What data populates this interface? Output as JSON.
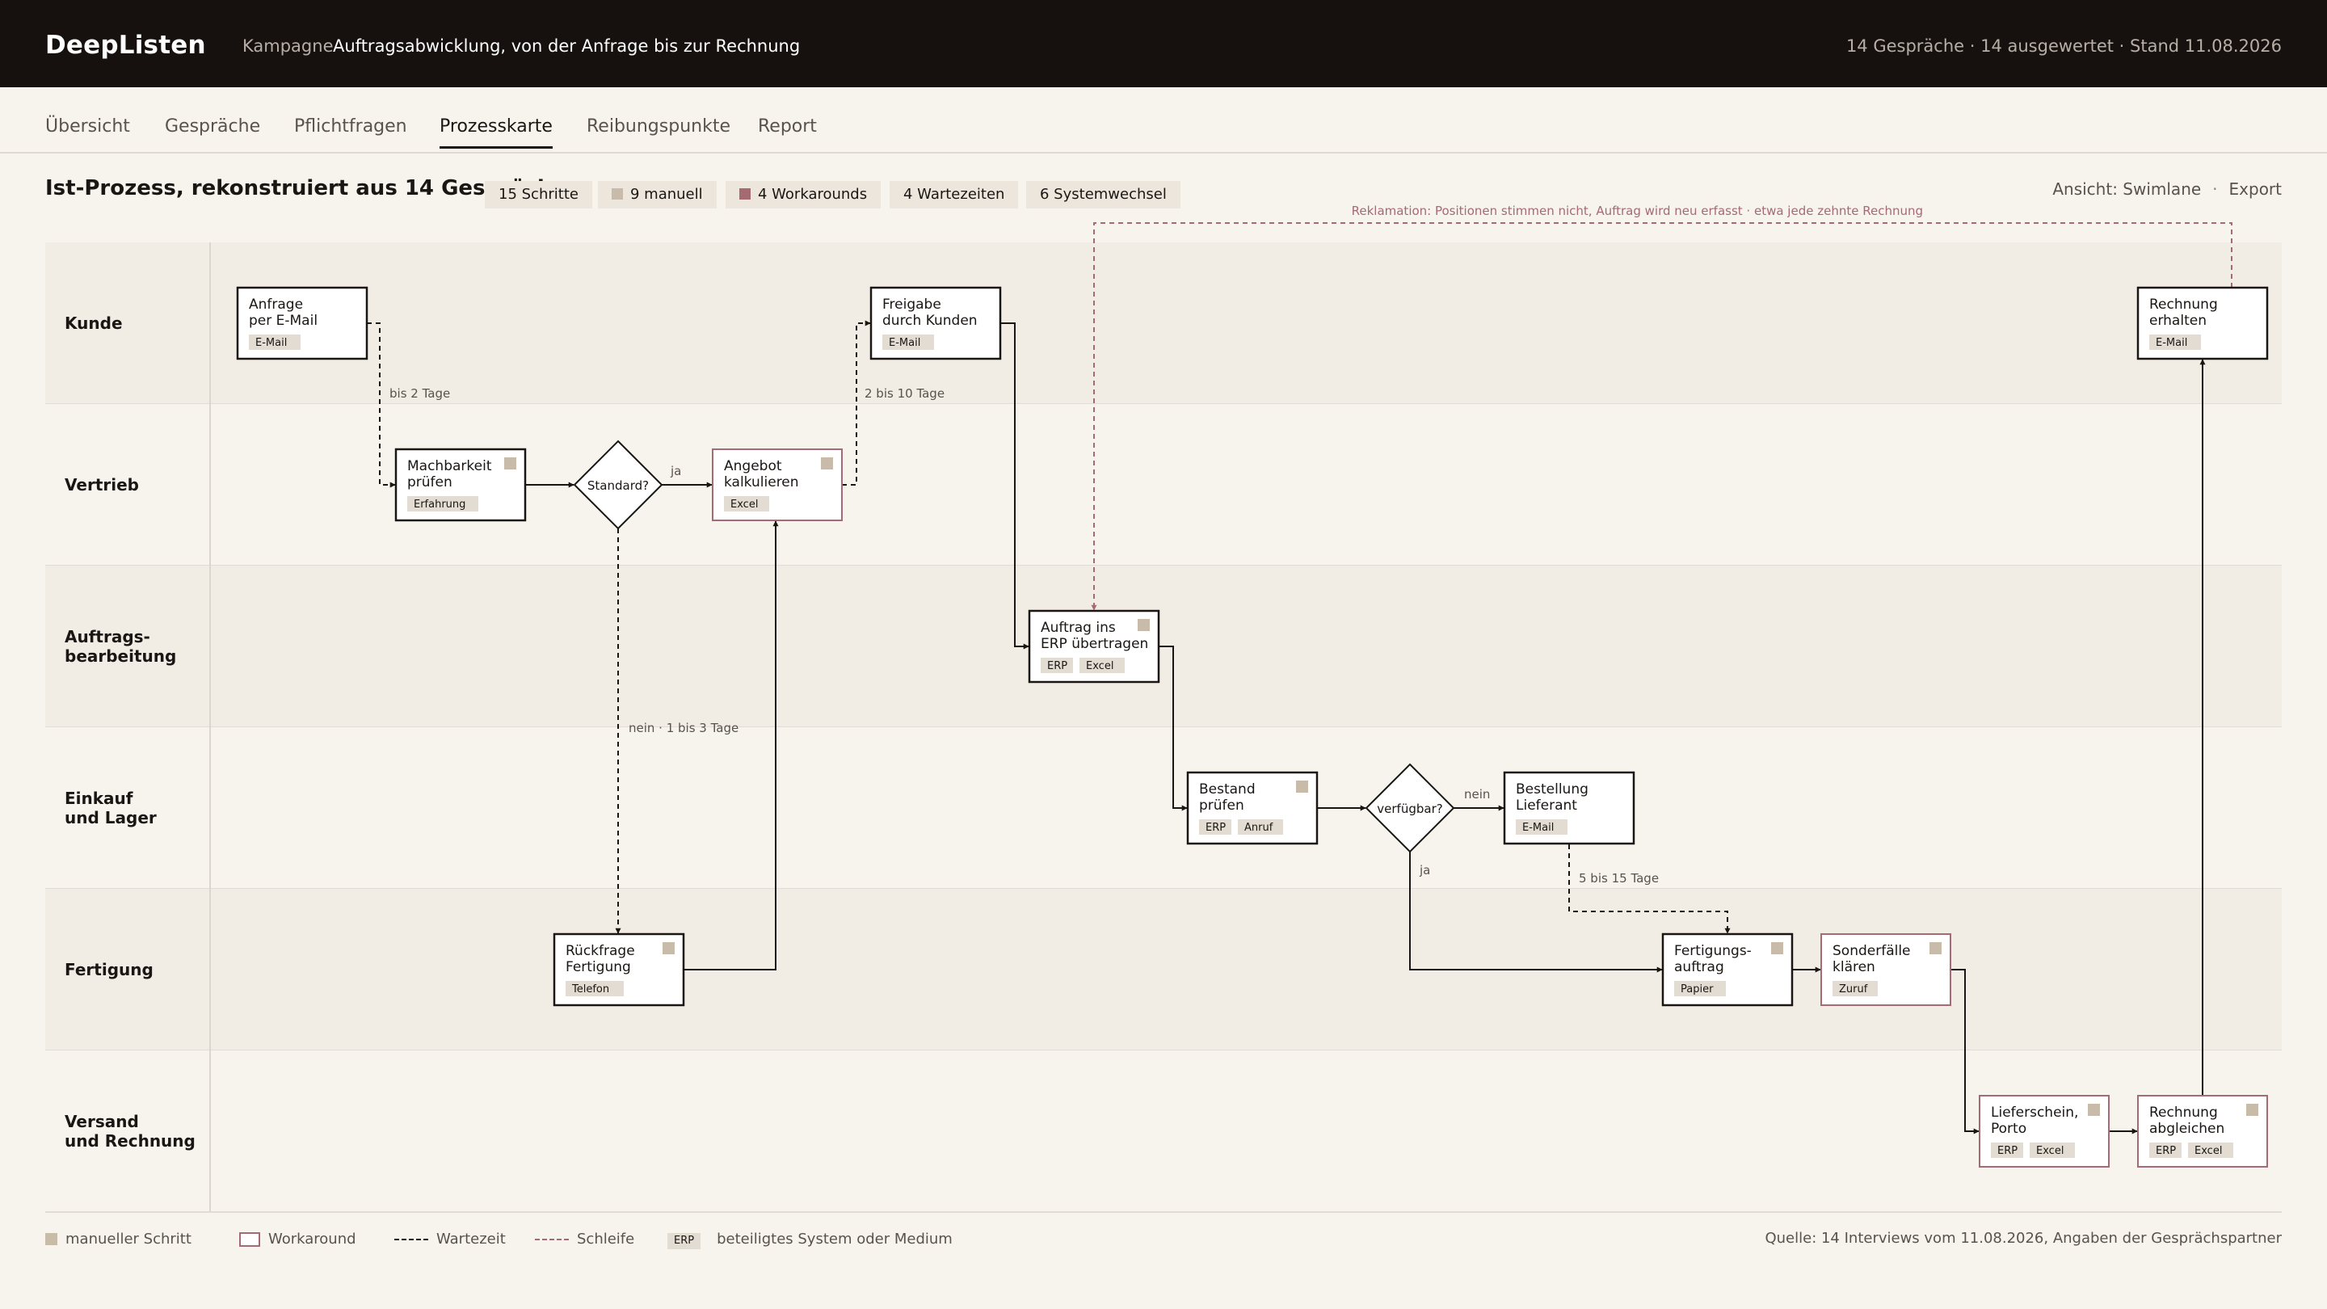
{
  "header": {
    "brand": "DeepListen",
    "campaign_label": "Kampagne",
    "campaign_title": "Auftragsabwicklung, von der Anfrage bis zur Rechnung",
    "stats": "14 Gespräche  ·  14 ausgewertet  ·  Stand 11.08.2026"
  },
  "tabs": [
    {
      "label": "Übersicht",
      "active": false
    },
    {
      "label": "Gespräche",
      "active": false
    },
    {
      "label": "Pflichtfragen",
      "active": false
    },
    {
      "label": "Prozesskarte",
      "active": true
    },
    {
      "label": "Reibungspunkte",
      "active": false
    },
    {
      "label": "Report",
      "active": false
    }
  ],
  "page": {
    "title": "Ist-Prozess, rekonstruiert aus 14 Gesprächen",
    "chips": [
      "15 Schritte",
      "9 manuell",
      "4 Workarounds",
      "4 Wartezeiten",
      "6 Systemwechsel"
    ],
    "view_label": "Ansicht: Swimlane",
    "export_label": "Export"
  },
  "colors": {
    "manual": "#c9bba9",
    "workaround": "#a56a73",
    "loop": "#a56a73",
    "lane_alt": "#f1ece4",
    "text": "#1a1614"
  },
  "diagram": {
    "lanes": [
      {
        "label": "Kunde"
      },
      {
        "label": "Vertrieb"
      },
      {
        "label": "Auftrags-\nbearbeitung"
      },
      {
        "label": "Einkauf\nund Lager"
      },
      {
        "label": "Fertigung"
      },
      {
        "label": "Versand\nund Rechnung"
      }
    ],
    "nodes": [
      {
        "id": "anfrage",
        "lines": [
          "Anfrage",
          "per E-Mail"
        ],
        "tags": [
          "E-Mail"
        ],
        "manual": false,
        "workaround": false
      },
      {
        "id": "machbarkeit",
        "lines": [
          "Machbarkeit",
          "prüfen"
        ],
        "tags": [
          "Erfahrung"
        ],
        "manual": true,
        "workaround": false
      },
      {
        "id": "standard",
        "type": "decision",
        "label": "Standard?"
      },
      {
        "id": "angebot",
        "lines": [
          "Angebot",
          "kalkulieren"
        ],
        "tags": [
          "Excel"
        ],
        "manual": true,
        "workaround": true
      },
      {
        "id": "freigabe",
        "lines": [
          "Freigabe",
          "durch Kunden"
        ],
        "tags": [
          "E-Mail"
        ],
        "manual": false,
        "workaround": false
      },
      {
        "id": "rueckfrage",
        "lines": [
          "Rückfrage",
          "Fertigung"
        ],
        "tags": [
          "Telefon"
        ],
        "manual": true,
        "workaround": false
      },
      {
        "id": "erp",
        "lines": [
          "Auftrag ins",
          "ERP übertragen"
        ],
        "tags": [
          "ERP",
          "Excel"
        ],
        "manual": true,
        "workaround": false
      },
      {
        "id": "bestand",
        "lines": [
          "Bestand",
          "prüfen"
        ],
        "tags": [
          "ERP",
          "Anruf"
        ],
        "manual": true,
        "workaround": false
      },
      {
        "id": "verfuegbar",
        "type": "decision",
        "label": "verfügbar?"
      },
      {
        "id": "bestellung",
        "lines": [
          "Bestellung",
          "Lieferant"
        ],
        "tags": [
          "E-Mail"
        ],
        "manual": false,
        "workaround": false
      },
      {
        "id": "fertigung",
        "lines": [
          "Fertigungs-",
          "auftrag"
        ],
        "tags": [
          "Papier"
        ],
        "manual": true,
        "workaround": false
      },
      {
        "id": "sonder",
        "lines": [
          "Sonderfälle",
          "klären"
        ],
        "tags": [
          "Zuruf"
        ],
        "manual": true,
        "workaround": true
      },
      {
        "id": "lieferschein",
        "lines": [
          "Lieferschein,",
          "Porto"
        ],
        "tags": [
          "ERP",
          "Excel"
        ],
        "manual": true,
        "workaround": true
      },
      {
        "id": "abgleich",
        "lines": [
          "Rechnung",
          "abgleichen"
        ],
        "tags": [
          "ERP",
          "Excel"
        ],
        "manual": true,
        "workaround": true
      },
      {
        "id": "rechnung",
        "lines": [
          "Rechnung",
          "erhalten"
        ],
        "tags": [
          "E-Mail"
        ],
        "manual": false,
        "workaround": false
      }
    ],
    "edge_labels": {
      "wait_anfrage": "bis 2 Tage",
      "wait_freigabe": "2 bis 10 Tage",
      "standard_yes": "ja",
      "standard_no": "nein  ·  1 bis 3 Tage",
      "verf_no": "nein",
      "verf_yes": "ja",
      "wait_bestellung": "5 bis 15 Tage",
      "loop": "Reklamation: Positionen stimmen nicht, Auftrag wird neu erfasst  ·  etwa jede zehnte Rechnung"
    }
  },
  "legend": {
    "manual": "manueller Schritt",
    "workaround": "Workaround",
    "wait": "Wartezeit",
    "loop": "Schleife",
    "system_tag": "ERP",
    "system": "beteiligtes System oder Medium"
  },
  "source": "Quelle: 14 Interviews vom 11.08.2026, Angaben der Gesprächspartner"
}
